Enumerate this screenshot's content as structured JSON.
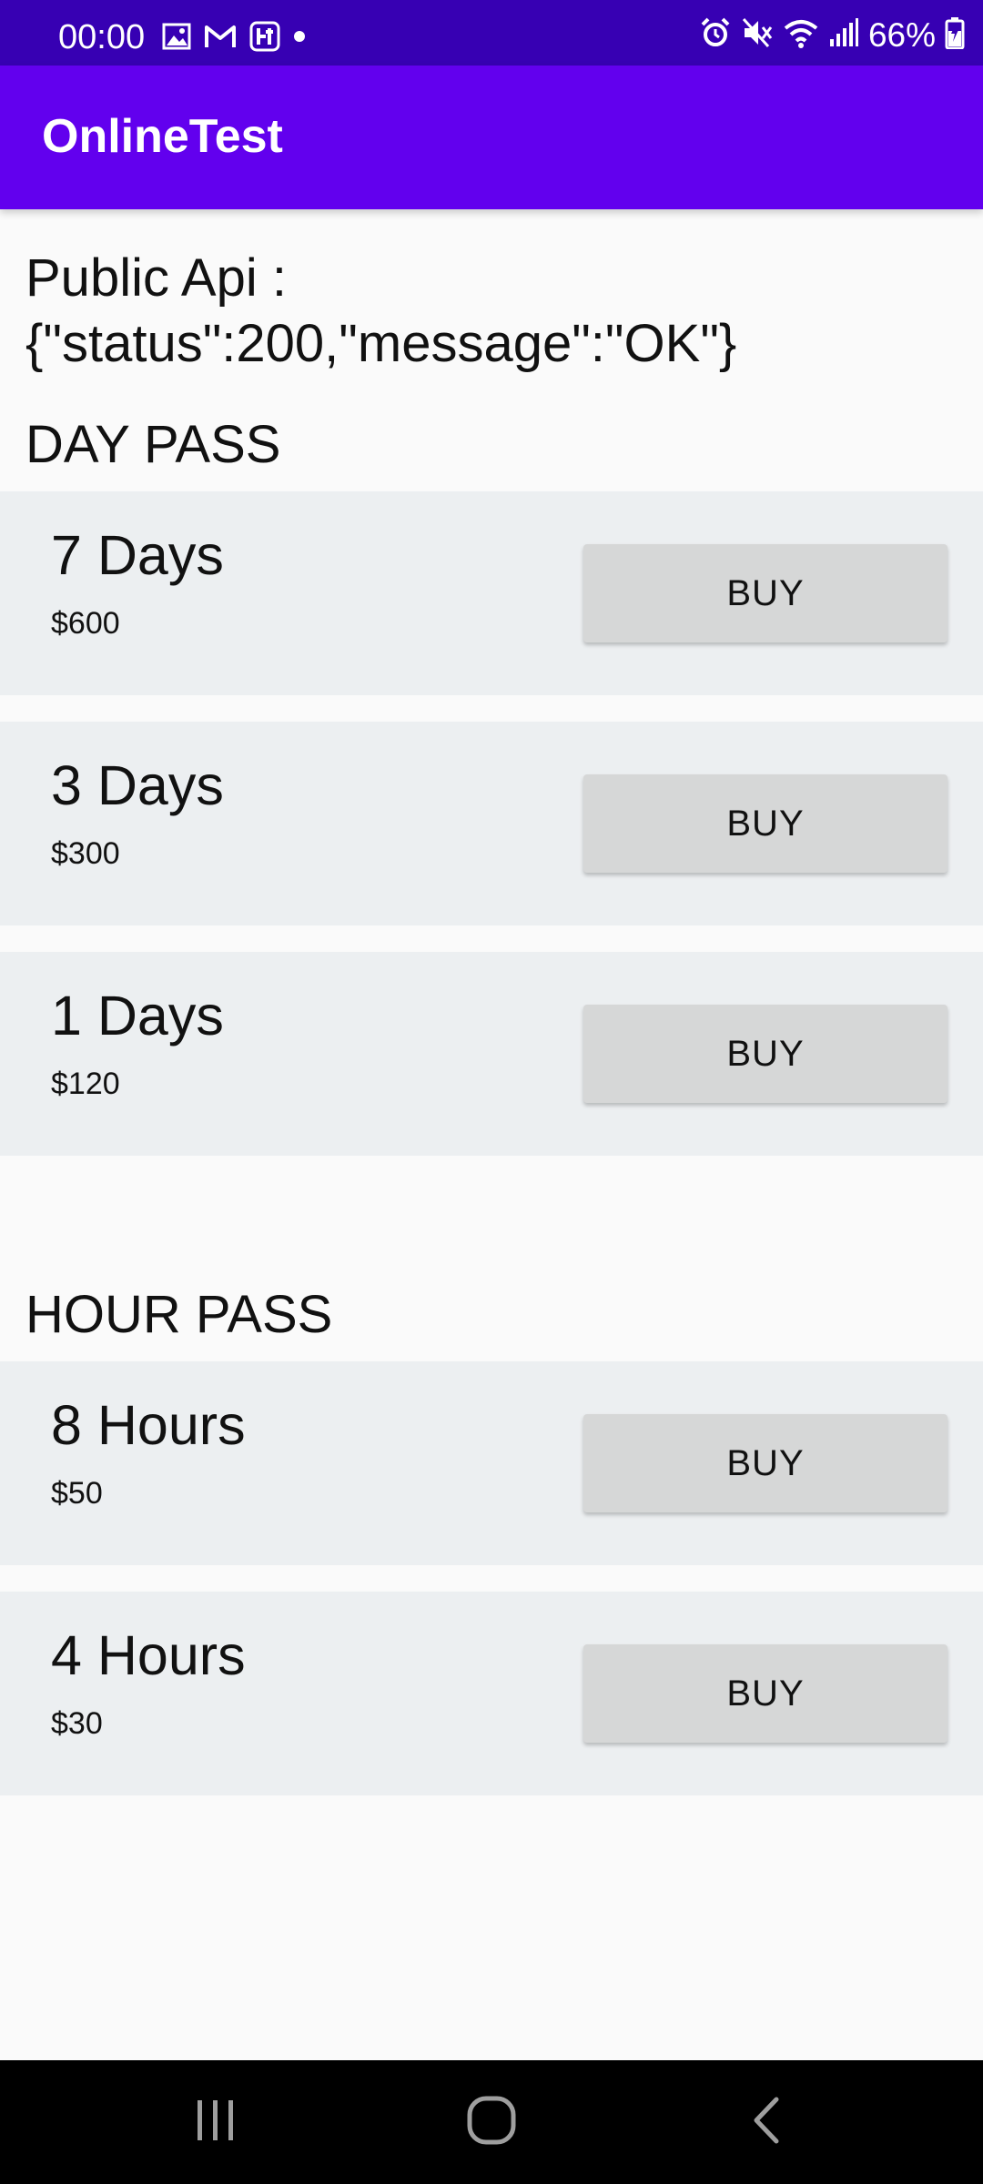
{
  "status_bar": {
    "time": "00:00",
    "battery": "66%",
    "left_icons": [
      "gallery-icon",
      "gmail-icon",
      "app-notification-icon",
      "dot-icon"
    ],
    "right_icons": [
      "alarm-icon",
      "mute-icon",
      "wifi-icon",
      "signal-icon",
      "battery-charging-icon"
    ],
    "background": "#3700b3"
  },
  "app_bar": {
    "title": "OnlineTest",
    "background": "#6200ee"
  },
  "api": {
    "line1": "Public Api :",
    "line2": "{\"status\":200,\"message\":\"OK\"}"
  },
  "day_pass": {
    "title": "DAY PASS",
    "items": [
      {
        "name": "7 Days",
        "price": "$600",
        "button": "BUY"
      },
      {
        "name": "3 Days",
        "price": "$300",
        "button": "BUY"
      },
      {
        "name": "1 Days",
        "price": "$120",
        "button": "BUY"
      }
    ]
  },
  "hour_pass": {
    "title": "HOUR PASS",
    "items": [
      {
        "name": "8 Hours",
        "price": "$50",
        "button": "BUY"
      },
      {
        "name": "4 Hours",
        "price": "$30",
        "button": "BUY"
      }
    ]
  },
  "nav_bar": {
    "buttons": [
      "recent-apps-icon",
      "home-icon",
      "back-icon"
    ]
  }
}
